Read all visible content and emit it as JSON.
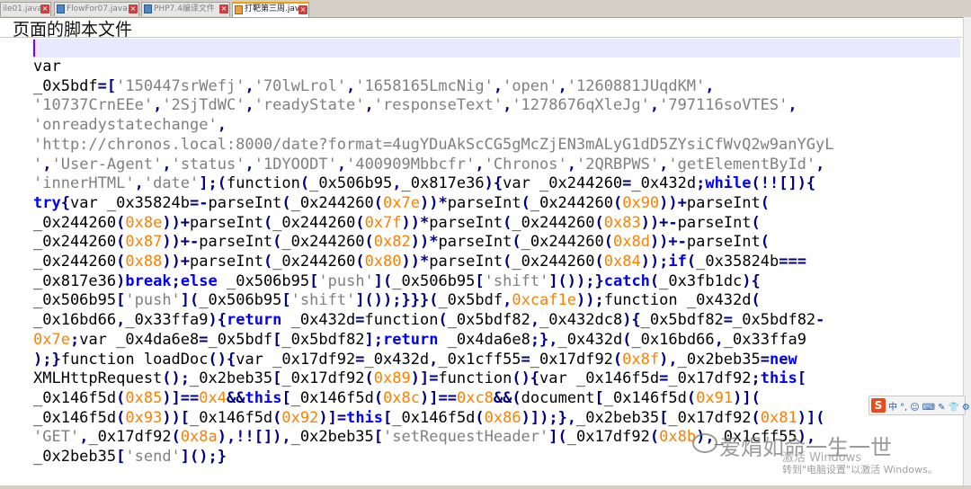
{
  "tabs": [
    {
      "label": "ile01.java",
      "active": false
    },
    {
      "label": "FlowFor07.java",
      "active": false
    },
    {
      "label": "PHP7.4编译文件",
      "active": false
    },
    {
      "label": "打靶第三周.java",
      "active": true
    }
  ],
  "page_title": "页面的脚本文件",
  "code_lines": [
    [
      {
        "t": "var",
        "c": "p"
      }
    ],
    [
      {
        "t": "_0x5bdf",
        "c": "p"
      },
      {
        "t": "=[",
        "c": "op"
      },
      {
        "t": "'150447srWefj'",
        "c": "str"
      },
      {
        "t": ",",
        "c": "op"
      },
      {
        "t": "'70lwLrol'",
        "c": "str"
      },
      {
        "t": ",",
        "c": "op"
      },
      {
        "t": "'1658165LmcNig'",
        "c": "str"
      },
      {
        "t": ",",
        "c": "op"
      },
      {
        "t": "'open'",
        "c": "str"
      },
      {
        "t": ",",
        "c": "op"
      },
      {
        "t": "'1260881JUqdKM'",
        "c": "str"
      },
      {
        "t": ",",
        "c": "op"
      }
    ],
    [
      {
        "t": "'10737CrnEEe'",
        "c": "str"
      },
      {
        "t": ",",
        "c": "op"
      },
      {
        "t": "'2SjTdWC'",
        "c": "str"
      },
      {
        "t": ",",
        "c": "op"
      },
      {
        "t": "'readyState'",
        "c": "str"
      },
      {
        "t": ",",
        "c": "op"
      },
      {
        "t": "'responseText'",
        "c": "str"
      },
      {
        "t": ",",
        "c": "op"
      },
      {
        "t": "'1278676qXleJg'",
        "c": "str"
      },
      {
        "t": ",",
        "c": "op"
      },
      {
        "t": "'797116soVTES'",
        "c": "str"
      },
      {
        "t": ",",
        "c": "op"
      }
    ],
    [
      {
        "t": "'onreadystatechange'",
        "c": "str"
      },
      {
        "t": ",",
        "c": "op"
      }
    ],
    [
      {
        "t": "'http://chronos.local:8000/date?format=4ugYDuAkScCG5gMcZjEN3mALyG1dD5ZYsiCfWvQ2w9anYGyL",
        "c": "str"
      }
    ],
    [
      {
        "t": "'",
        "c": "str"
      },
      {
        "t": ",",
        "c": "op"
      },
      {
        "t": "'User-Agent'",
        "c": "str"
      },
      {
        "t": ",",
        "c": "op"
      },
      {
        "t": "'status'",
        "c": "str"
      },
      {
        "t": ",",
        "c": "op"
      },
      {
        "t": "'1DYOODT'",
        "c": "str"
      },
      {
        "t": ",",
        "c": "op"
      },
      {
        "t": "'400909Mbbcfr'",
        "c": "str"
      },
      {
        "t": ",",
        "c": "op"
      },
      {
        "t": "'Chronos'",
        "c": "str"
      },
      {
        "t": ",",
        "c": "op"
      },
      {
        "t": "'2QRBPWS'",
        "c": "str"
      },
      {
        "t": ",",
        "c": "op"
      },
      {
        "t": "'getElementById'",
        "c": "str"
      },
      {
        "t": ",",
        "c": "op"
      }
    ],
    [
      {
        "t": "'innerHTML'",
        "c": "str"
      },
      {
        "t": ",",
        "c": "op"
      },
      {
        "t": "'date'",
        "c": "str"
      },
      {
        "t": "];(",
        "c": "op"
      },
      {
        "t": "function",
        "c": "p"
      },
      {
        "t": "(",
        "c": "op"
      },
      {
        "t": "_0x506b95",
        "c": "p"
      },
      {
        "t": ",",
        "c": "op"
      },
      {
        "t": "_0x817e36",
        "c": "p"
      },
      {
        "t": "){",
        "c": "op"
      },
      {
        "t": "var _0x244260",
        "c": "p"
      },
      {
        "t": "=",
        "c": "op"
      },
      {
        "t": "_0x432d",
        "c": "p"
      },
      {
        "t": ";",
        "c": "op"
      },
      {
        "t": "while",
        "c": "kw"
      },
      {
        "t": "(!![]){",
        "c": "op"
      }
    ],
    [
      {
        "t": "try",
        "c": "kw"
      },
      {
        "t": "{",
        "c": "op"
      },
      {
        "t": "var _0x35824b",
        "c": "p"
      },
      {
        "t": "=-",
        "c": "op"
      },
      {
        "t": "parseInt",
        "c": "p"
      },
      {
        "t": "(",
        "c": "op"
      },
      {
        "t": "_0x244260",
        "c": "p"
      },
      {
        "t": "(",
        "c": "op"
      },
      {
        "t": "0x7e",
        "c": "num"
      },
      {
        "t": "))*",
        "c": "op"
      },
      {
        "t": "parseInt",
        "c": "p"
      },
      {
        "t": "(",
        "c": "op"
      },
      {
        "t": "_0x244260",
        "c": "p"
      },
      {
        "t": "(",
        "c": "op"
      },
      {
        "t": "0x90",
        "c": "num"
      },
      {
        "t": "))+",
        "c": "op"
      },
      {
        "t": "parseInt",
        "c": "p"
      },
      {
        "t": "(",
        "c": "op"
      }
    ],
    [
      {
        "t": "_0x244260",
        "c": "p"
      },
      {
        "t": "(",
        "c": "op"
      },
      {
        "t": "0x8e",
        "c": "num"
      },
      {
        "t": "))+",
        "c": "op"
      },
      {
        "t": "parseInt",
        "c": "p"
      },
      {
        "t": "(",
        "c": "op"
      },
      {
        "t": "_0x244260",
        "c": "p"
      },
      {
        "t": "(",
        "c": "op"
      },
      {
        "t": "0x7f",
        "c": "num"
      },
      {
        "t": "))*",
        "c": "op"
      },
      {
        "t": "parseInt",
        "c": "p"
      },
      {
        "t": "(",
        "c": "op"
      },
      {
        "t": "_0x244260",
        "c": "p"
      },
      {
        "t": "(",
        "c": "op"
      },
      {
        "t": "0x83",
        "c": "num"
      },
      {
        "t": "))+-",
        "c": "op"
      },
      {
        "t": "parseInt",
        "c": "p"
      },
      {
        "t": "(",
        "c": "op"
      }
    ],
    [
      {
        "t": "_0x244260",
        "c": "p"
      },
      {
        "t": "(",
        "c": "op"
      },
      {
        "t": "0x87",
        "c": "num"
      },
      {
        "t": "))+-",
        "c": "op"
      },
      {
        "t": "parseInt",
        "c": "p"
      },
      {
        "t": "(",
        "c": "op"
      },
      {
        "t": "_0x244260",
        "c": "p"
      },
      {
        "t": "(",
        "c": "op"
      },
      {
        "t": "0x82",
        "c": "num"
      },
      {
        "t": "))*",
        "c": "op"
      },
      {
        "t": "parseInt",
        "c": "p"
      },
      {
        "t": "(",
        "c": "op"
      },
      {
        "t": "_0x244260",
        "c": "p"
      },
      {
        "t": "(",
        "c": "op"
      },
      {
        "t": "0x8d",
        "c": "num"
      },
      {
        "t": "))+-",
        "c": "op"
      },
      {
        "t": "parseInt",
        "c": "p"
      },
      {
        "t": "(",
        "c": "op"
      }
    ],
    [
      {
        "t": "_0x244260",
        "c": "p"
      },
      {
        "t": "(",
        "c": "op"
      },
      {
        "t": "0x88",
        "c": "num"
      },
      {
        "t": "))+",
        "c": "op"
      },
      {
        "t": "parseInt",
        "c": "p"
      },
      {
        "t": "(",
        "c": "op"
      },
      {
        "t": "_0x244260",
        "c": "p"
      },
      {
        "t": "(",
        "c": "op"
      },
      {
        "t": "0x80",
        "c": "num"
      },
      {
        "t": "))*",
        "c": "op"
      },
      {
        "t": "parseInt",
        "c": "p"
      },
      {
        "t": "(",
        "c": "op"
      },
      {
        "t": "_0x244260",
        "c": "p"
      },
      {
        "t": "(",
        "c": "op"
      },
      {
        "t": "0x84",
        "c": "num"
      },
      {
        "t": "));",
        "c": "op"
      },
      {
        "t": "if",
        "c": "kw"
      },
      {
        "t": "(",
        "c": "op"
      },
      {
        "t": "_0x35824b",
        "c": "p"
      },
      {
        "t": "===",
        "c": "op"
      }
    ],
    [
      {
        "t": "_0x817e36",
        "c": "p"
      },
      {
        "t": ")",
        "c": "op"
      },
      {
        "t": "break",
        "c": "kw"
      },
      {
        "t": ";",
        "c": "op"
      },
      {
        "t": "else",
        "c": "kw"
      },
      {
        "t": " _0x506b95",
        "c": "p"
      },
      {
        "t": "[",
        "c": "op"
      },
      {
        "t": "'push'",
        "c": "str"
      },
      {
        "t": "](",
        "c": "op"
      },
      {
        "t": "_0x506b95",
        "c": "p"
      },
      {
        "t": "[",
        "c": "op"
      },
      {
        "t": "'shift'",
        "c": "str"
      },
      {
        "t": "]());}",
        "c": "op"
      },
      {
        "t": "catch",
        "c": "kw"
      },
      {
        "t": "(",
        "c": "op"
      },
      {
        "t": "_0x3fb1dc",
        "c": "p"
      },
      {
        "t": "){",
        "c": "op"
      }
    ],
    [
      {
        "t": "_0x506b95",
        "c": "p"
      },
      {
        "t": "[",
        "c": "op"
      },
      {
        "t": "'push'",
        "c": "str"
      },
      {
        "t": "](",
        "c": "op"
      },
      {
        "t": "_0x506b95",
        "c": "p"
      },
      {
        "t": "[",
        "c": "op"
      },
      {
        "t": "'shift'",
        "c": "str"
      },
      {
        "t": "]());}}}(",
        "c": "op"
      },
      {
        "t": "_0x5bdf",
        "c": "p"
      },
      {
        "t": ",",
        "c": "op"
      },
      {
        "t": "0xcaf1e",
        "c": "num"
      },
      {
        "t": "));",
        "c": "op"
      },
      {
        "t": "function _0x432d",
        "c": "p"
      },
      {
        "t": "(",
        "c": "op"
      }
    ],
    [
      {
        "t": "_0x16bd66",
        "c": "p"
      },
      {
        "t": ",",
        "c": "op"
      },
      {
        "t": "_0x33ffa9",
        "c": "p"
      },
      {
        "t": "){",
        "c": "op"
      },
      {
        "t": "return",
        "c": "kw"
      },
      {
        "t": " _0x432d",
        "c": "p"
      },
      {
        "t": "=",
        "c": "op"
      },
      {
        "t": "function",
        "c": "p"
      },
      {
        "t": "(",
        "c": "op"
      },
      {
        "t": "_0x5bdf82",
        "c": "p"
      },
      {
        "t": ",",
        "c": "op"
      },
      {
        "t": "_0x432dc8",
        "c": "p"
      },
      {
        "t": "){",
        "c": "op"
      },
      {
        "t": "_0x5bdf82",
        "c": "p"
      },
      {
        "t": "=",
        "c": "op"
      },
      {
        "t": "_0x5bdf82",
        "c": "p"
      },
      {
        "t": "-",
        "c": "op"
      }
    ],
    [
      {
        "t": "0x7e",
        "c": "num"
      },
      {
        "t": ";",
        "c": "op"
      },
      {
        "t": "var _0x4da6e8",
        "c": "p"
      },
      {
        "t": "=",
        "c": "op"
      },
      {
        "t": "_0x5bdf",
        "c": "p"
      },
      {
        "t": "[",
        "c": "op"
      },
      {
        "t": "_0x5bdf82",
        "c": "p"
      },
      {
        "t": "];",
        "c": "op"
      },
      {
        "t": "return",
        "c": "kw"
      },
      {
        "t": " _0x4da6e8",
        "c": "p"
      },
      {
        "t": ";},",
        "c": "op"
      },
      {
        "t": "_0x432d",
        "c": "p"
      },
      {
        "t": "(",
        "c": "op"
      },
      {
        "t": "_0x16bd66",
        "c": "p"
      },
      {
        "t": ",",
        "c": "op"
      },
      {
        "t": "_0x33ffa9",
        "c": "p"
      }
    ],
    [
      {
        "t": ");}",
        "c": "op"
      },
      {
        "t": "function loadDoc",
        "c": "p"
      },
      {
        "t": "(){",
        "c": "op"
      },
      {
        "t": "var _0x17df92",
        "c": "p"
      },
      {
        "t": "=",
        "c": "op"
      },
      {
        "t": "_0x432d",
        "c": "p"
      },
      {
        "t": ",",
        "c": "op"
      },
      {
        "t": "_0x1cff55",
        "c": "p"
      },
      {
        "t": "=",
        "c": "op"
      },
      {
        "t": "_0x17df92",
        "c": "p"
      },
      {
        "t": "(",
        "c": "op"
      },
      {
        "t": "0x8f",
        "c": "num"
      },
      {
        "t": "),",
        "c": "op"
      },
      {
        "t": "_0x2beb35",
        "c": "p"
      },
      {
        "t": "=",
        "c": "op"
      },
      {
        "t": "new",
        "c": "kw"
      }
    ],
    [
      {
        "t": "XMLHttpRequest",
        "c": "p"
      },
      {
        "t": "();",
        "c": "op"
      },
      {
        "t": "_0x2beb35",
        "c": "p"
      },
      {
        "t": "[",
        "c": "op"
      },
      {
        "t": "_0x17df92",
        "c": "p"
      },
      {
        "t": "(",
        "c": "op"
      },
      {
        "t": "0x89",
        "c": "num"
      },
      {
        "t": ")]=",
        "c": "op"
      },
      {
        "t": "function",
        "c": "p"
      },
      {
        "t": "(){",
        "c": "op"
      },
      {
        "t": "var _0x146f5d",
        "c": "p"
      },
      {
        "t": "=",
        "c": "op"
      },
      {
        "t": "_0x17df92",
        "c": "p"
      },
      {
        "t": ";",
        "c": "op"
      },
      {
        "t": "this",
        "c": "kw"
      },
      {
        "t": "[",
        "c": "op"
      }
    ],
    [
      {
        "t": "_0x146f5d",
        "c": "p"
      },
      {
        "t": "(",
        "c": "op"
      },
      {
        "t": "0x85",
        "c": "num"
      },
      {
        "t": ")]==",
        "c": "op"
      },
      {
        "t": "0x4",
        "c": "num"
      },
      {
        "t": "&&",
        "c": "op"
      },
      {
        "t": "this",
        "c": "kw"
      },
      {
        "t": "[",
        "c": "op"
      },
      {
        "t": "_0x146f5d",
        "c": "p"
      },
      {
        "t": "(",
        "c": "op"
      },
      {
        "t": "0x8c",
        "c": "num"
      },
      {
        "t": ")]==",
        "c": "op"
      },
      {
        "t": "0xc8",
        "c": "num"
      },
      {
        "t": "&&(",
        "c": "op"
      },
      {
        "t": "document",
        "c": "p"
      },
      {
        "t": "[",
        "c": "op"
      },
      {
        "t": "_0x146f5d",
        "c": "p"
      },
      {
        "t": "(",
        "c": "op"
      },
      {
        "t": "0x91",
        "c": "num"
      },
      {
        "t": ")](",
        "c": "op"
      }
    ],
    [
      {
        "t": "_0x146f5d",
        "c": "p"
      },
      {
        "t": "(",
        "c": "op"
      },
      {
        "t": "0x93",
        "c": "num"
      },
      {
        "t": "))[",
        "c": "op"
      },
      {
        "t": "_0x146f5d",
        "c": "p"
      },
      {
        "t": "(",
        "c": "op"
      },
      {
        "t": "0x92",
        "c": "num"
      },
      {
        "t": ")]=",
        "c": "op"
      },
      {
        "t": "this",
        "c": "kw"
      },
      {
        "t": "[",
        "c": "op"
      },
      {
        "t": "_0x146f5d",
        "c": "p"
      },
      {
        "t": "(",
        "c": "op"
      },
      {
        "t": "0x86",
        "c": "num"
      },
      {
        "t": ")]);},",
        "c": "op"
      },
      {
        "t": "_0x2beb35",
        "c": "p"
      },
      {
        "t": "[",
        "c": "op"
      },
      {
        "t": "_0x17df92",
        "c": "p"
      },
      {
        "t": "(",
        "c": "op"
      },
      {
        "t": "0x81",
        "c": "num"
      },
      {
        "t": ")](",
        "c": "op"
      }
    ],
    [
      {
        "t": "'GET'",
        "c": "str"
      },
      {
        "t": ",",
        "c": "op"
      },
      {
        "t": "_0x17df92",
        "c": "p"
      },
      {
        "t": "(",
        "c": "op"
      },
      {
        "t": "0x8a",
        "c": "num"
      },
      {
        "t": "),!![]),",
        "c": "op"
      },
      {
        "t": "_0x2beb35",
        "c": "p"
      },
      {
        "t": "[",
        "c": "op"
      },
      {
        "t": "'setRequestHeader'",
        "c": "str"
      },
      {
        "t": "](",
        "c": "op"
      },
      {
        "t": "_0x17df92",
        "c": "p"
      },
      {
        "t": "(",
        "c": "op"
      },
      {
        "t": "0x8b",
        "c": "num"
      },
      {
        "t": "),",
        "c": "op"
      },
      {
        "t": "_0x1cff55",
        "c": "p"
      },
      {
        "t": "),",
        "c": "op"
      }
    ],
    [
      {
        "t": "_0x2beb35",
        "c": "p"
      },
      {
        "t": "[",
        "c": "op"
      },
      {
        "t": "'send'",
        "c": "str"
      },
      {
        "t": "]();}",
        "c": "op"
      }
    ]
  ],
  "ime_toolbar": {
    "logo": "S",
    "items": [
      "中",
      "°,",
      "☺",
      "⌨",
      "✎",
      "👕",
      "⚙"
    ]
  },
  "watermark": {
    "text": "爱焆如命一生一世"
  },
  "activation": {
    "line1": "激活 Windows",
    "line2": "转到\"电脑设置\"以激活 Windows。"
  }
}
